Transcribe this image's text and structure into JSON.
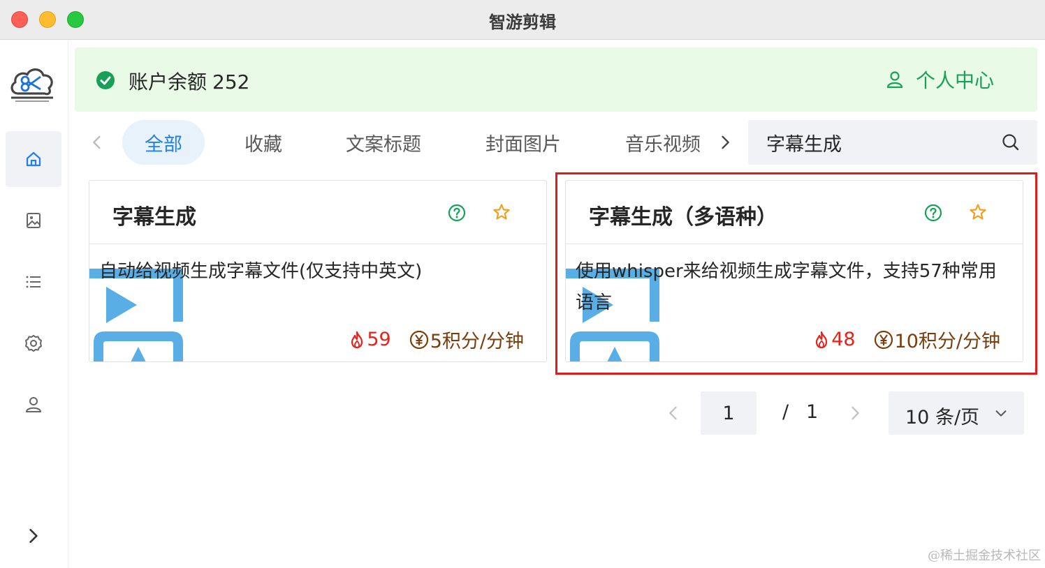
{
  "window": {
    "title": "智游剪辑"
  },
  "sidebar": {
    "items": [
      {
        "icon": "home-icon",
        "active": true
      },
      {
        "icon": "image-icon",
        "active": false
      },
      {
        "icon": "list-icon",
        "active": false
      },
      {
        "icon": "gear-icon",
        "active": false
      },
      {
        "icon": "user-icon",
        "active": false
      }
    ],
    "collapse_icon": "chevron-right-icon"
  },
  "account": {
    "balance_label": "账户余额",
    "balance_value": "252",
    "user_center_label": "个人中心",
    "accent_color": "#18a058"
  },
  "tabs": {
    "items": [
      {
        "label": "全部",
        "active": true
      },
      {
        "label": "收藏",
        "active": false
      },
      {
        "label": "文案标题",
        "active": false
      },
      {
        "label": "封面图片",
        "active": false
      },
      {
        "label": "音乐视频",
        "active": false
      }
    ]
  },
  "search": {
    "value": "字幕生成",
    "placeholder": ""
  },
  "cards": [
    {
      "title": "字幕生成",
      "description": "自动给视频生成字幕文件(仅支持中英文)",
      "hot": "59",
      "price": "5积分/分钟",
      "highlighted": false
    },
    {
      "title": "字幕生成（多语种）",
      "description": "使用whisper来给视频生成字幕文件，支持57种常用语言",
      "hot": "48",
      "price": "10积分/分钟",
      "highlighted": true
    }
  ],
  "pagination": {
    "current": "1",
    "separator": "/",
    "total": "1",
    "page_size": "10 条/页"
  },
  "watermark": "@稀土掘金技术社区",
  "colors": {
    "primary": "#2080f0",
    "success": "#18a058",
    "hot": "#e8221b",
    "price": "#7a3e0c",
    "star": "#f0a020",
    "highlight_border": "#e01b1b"
  }
}
